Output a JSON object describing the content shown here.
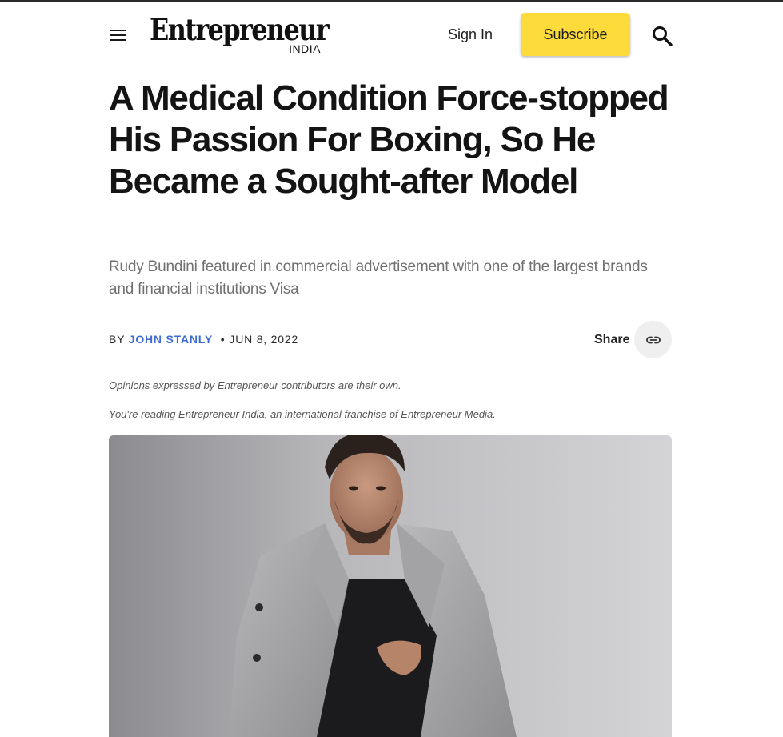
{
  "header": {
    "logo_name": "Entrepreneur",
    "logo_edition": "INDIA",
    "sign_in_label": "Sign In",
    "subscribe_label": "Subscribe",
    "icons": [
      "menu-icon",
      "search-icon"
    ]
  },
  "article": {
    "headline": "A Medical Condition Force-stopped His Passion For Boxing, So He Became a Sought-after Model",
    "dek": "Rudy Bundini featured in commercial advertisement with one of the largest brands and financial institutions Visa",
    "byline_prefix": "BY",
    "author": "JOHN STANLY",
    "separator": "•",
    "date": "JUN 8, 2022",
    "share_label": "Share",
    "share_icon": "link-icon",
    "opinion_note": "Opinions expressed by Entrepreneur contributors are their own.",
    "franchise_note": "You're reading Entrepreneur India, an international franchise of Entrepreneur Media."
  },
  "colors": {
    "subscribe_bg": "#fddb3a",
    "author_link": "#3d6bd3",
    "headline": "#141414",
    "dek": "#707070"
  }
}
